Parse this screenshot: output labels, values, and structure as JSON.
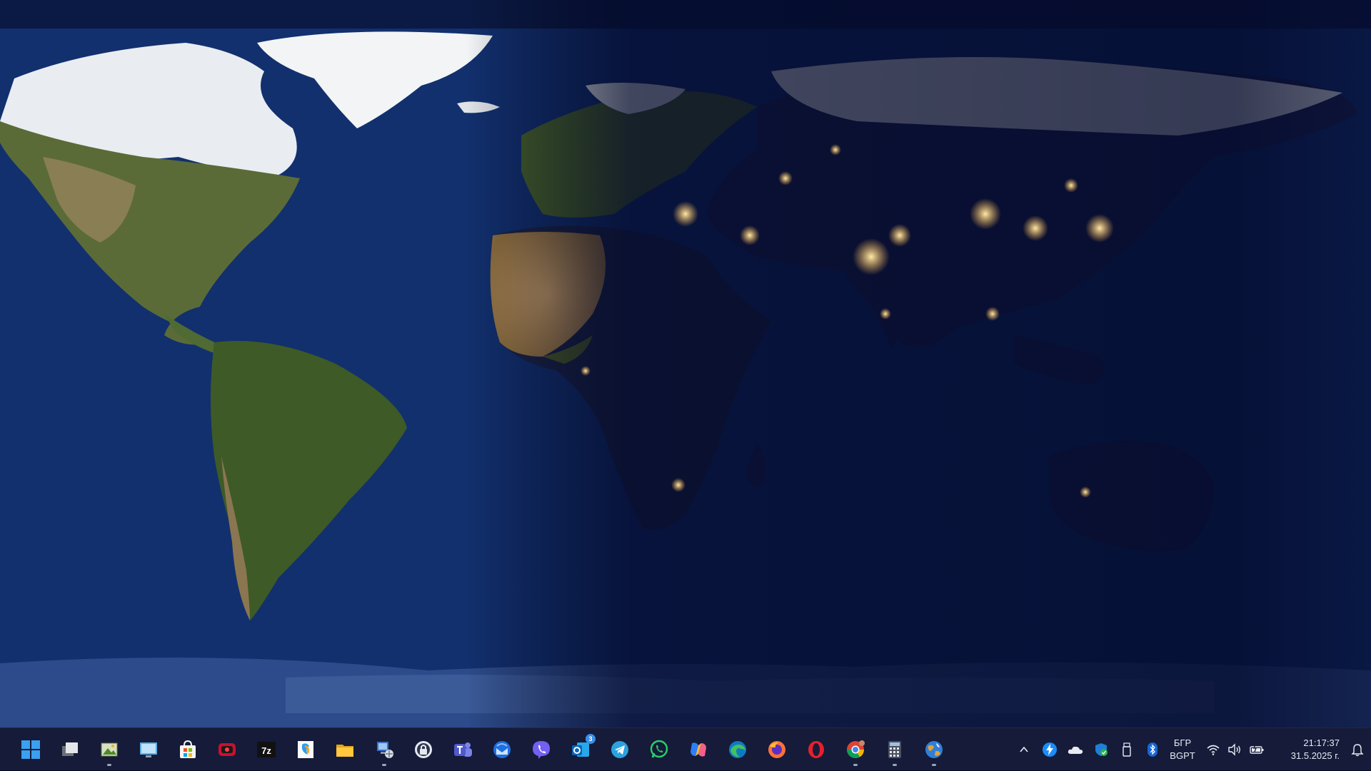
{
  "taskbar": {
    "apps": [
      {
        "name": "start-button",
        "icon": "windows-logo-icon",
        "running": false
      },
      {
        "name": "task-view-button",
        "icon": "task-view-icon",
        "running": false
      },
      {
        "name": "taskbar-app-image-viewer",
        "icon": "image-viewer-icon",
        "running": true
      },
      {
        "name": "taskbar-app-display-settings",
        "icon": "monitor-picture-icon",
        "running": false
      },
      {
        "name": "taskbar-app-microsoft-store",
        "icon": "store-bag-icon",
        "running": false
      },
      {
        "name": "taskbar-app-screen-recorder",
        "icon": "screen-recorder-icon",
        "running": false
      },
      {
        "name": "taskbar-app-7zip",
        "icon": "seven-zip-icon",
        "label": "7z",
        "running": false
      },
      {
        "name": "taskbar-app-sticky-pad",
        "icon": "colorful-pad-icon",
        "running": false
      },
      {
        "name": "taskbar-app-file-explorer",
        "icon": "folder-icon",
        "running": false
      },
      {
        "name": "taskbar-app-network-tool",
        "icon": "network-computer-icon",
        "running": true
      },
      {
        "name": "taskbar-app-vpn",
        "icon": "lock-shield-icon",
        "running": false
      },
      {
        "name": "taskbar-app-teams",
        "icon": "teams-icon",
        "running": false
      },
      {
        "name": "taskbar-app-thunderbird",
        "icon": "thunderbird-icon",
        "running": false
      },
      {
        "name": "taskbar-app-viber",
        "icon": "viber-icon",
        "running": false
      },
      {
        "name": "taskbar-app-outlook",
        "icon": "mail-icon",
        "badge": "3",
        "running": false
      },
      {
        "name": "taskbar-app-telegram",
        "icon": "telegram-icon",
        "running": false
      },
      {
        "name": "taskbar-app-whatsapp",
        "icon": "whatsapp-icon",
        "running": false
      },
      {
        "name": "taskbar-app-copilot",
        "icon": "copilot-icon",
        "running": false
      },
      {
        "name": "taskbar-app-edge",
        "icon": "edge-icon",
        "running": false
      },
      {
        "name": "taskbar-app-firefox",
        "icon": "firefox-icon",
        "running": false
      },
      {
        "name": "taskbar-app-opera",
        "icon": "opera-icon",
        "running": false
      },
      {
        "name": "taskbar-app-chrome",
        "icon": "chrome-icon",
        "running": true
      },
      {
        "name": "taskbar-app-calculator",
        "icon": "calculator-icon",
        "running": true
      },
      {
        "name": "taskbar-app-earth-wallpaper",
        "icon": "globe-icon",
        "running": true
      }
    ],
    "tray": {
      "language": {
        "top": "БГР",
        "bottom": "BGPT"
      },
      "time": "21:17:37",
      "date": "31.5.2025 г."
    }
  },
  "colors": {
    "taskbar": "#161c3a",
    "ocean": "#0f2660",
    "accent": "#3a8fe8"
  }
}
